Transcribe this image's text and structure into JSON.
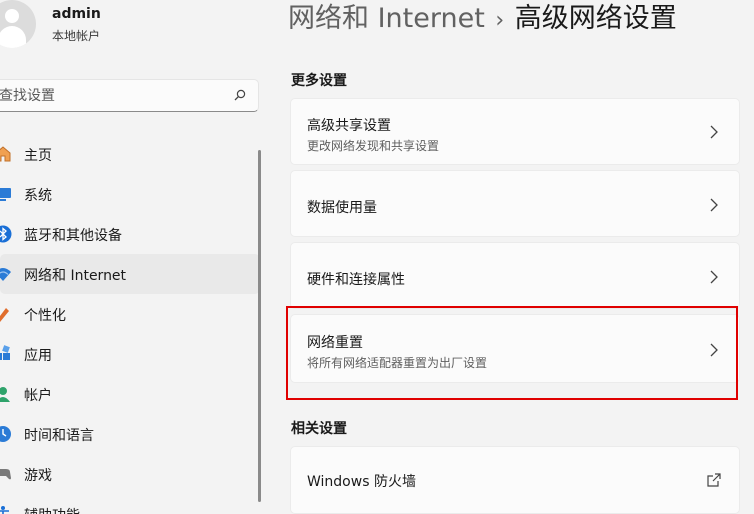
{
  "user": {
    "name": "admin",
    "account_type": "本地帐户"
  },
  "search": {
    "placeholder": "查找设置",
    "icon": "search-icon"
  },
  "nav": {
    "items": [
      {
        "label": "主页",
        "icon": "home-icon"
      },
      {
        "label": "系统",
        "icon": "system-icon"
      },
      {
        "label": "蓝牙和其他设备",
        "icon": "bluetooth-icon"
      },
      {
        "label": "网络和 Internet",
        "icon": "wifi-icon",
        "selected": true
      },
      {
        "label": "个性化",
        "icon": "personalization-icon"
      },
      {
        "label": "应用",
        "icon": "apps-icon"
      },
      {
        "label": "帐户",
        "icon": "account-icon"
      },
      {
        "label": "时间和语言",
        "icon": "time-language-icon"
      },
      {
        "label": "游戏",
        "icon": "gaming-icon"
      },
      {
        "label": "辅助功能",
        "icon": "accessibility-icon"
      }
    ]
  },
  "breadcrumb": {
    "parent": "网络和 Internet",
    "separator": "›",
    "current": "高级网络设置"
  },
  "more_settings": {
    "title": "更多设置",
    "items": [
      {
        "title": "高级共享设置",
        "description": "更改网络发现和共享设置"
      },
      {
        "title": "数据使用量"
      },
      {
        "title": "硬件和连接属性"
      },
      {
        "title": "网络重置",
        "description": "将所有网络适配器重置为出厂设置"
      }
    ]
  },
  "related_settings": {
    "title": "相关设置",
    "items": [
      {
        "title": "Windows 防火墙",
        "icon": "external-link-icon"
      }
    ]
  },
  "colors": {
    "highlight": "#e00000",
    "selected_nav_bg": "#e9e9e9",
    "background": "#f3f3f3"
  }
}
